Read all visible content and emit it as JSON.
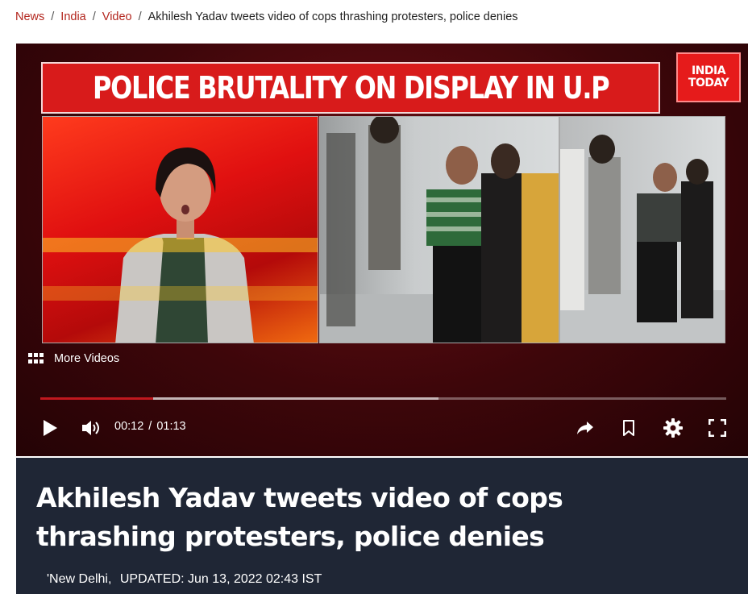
{
  "breadcrumb": {
    "items": [
      "News",
      "India",
      "Video"
    ],
    "separator": "/",
    "current": "Akhilesh Yadav tweets video of cops thrashing protesters, police denies"
  },
  "player": {
    "headline": "POLICE BRUTALITY ON DISPLAY IN U.P",
    "logo_line1": "INDIA",
    "logo_line2": "TODAY",
    "more_videos": "More Videos",
    "time_current": "00:12",
    "time_separator": "/",
    "time_total": "01:13",
    "progress_fraction": 0.164,
    "icons": [
      "play-icon",
      "volume-icon",
      "share-icon",
      "bookmark-icon",
      "gear-icon",
      "fullscreen-icon",
      "grid-icon"
    ]
  },
  "article": {
    "title": "Akhilesh Yadav tweets video of cops thrashing protesters, police denies",
    "location": "'New Delhi,",
    "updated": "UPDATED: Jun 13, 2022 02:43 IST"
  },
  "colors": {
    "breadcrumb_link": "#b3261e",
    "headline_bar": "#d81b1b",
    "article_bg": "#1f2635",
    "progress_played": "#c0181e"
  }
}
